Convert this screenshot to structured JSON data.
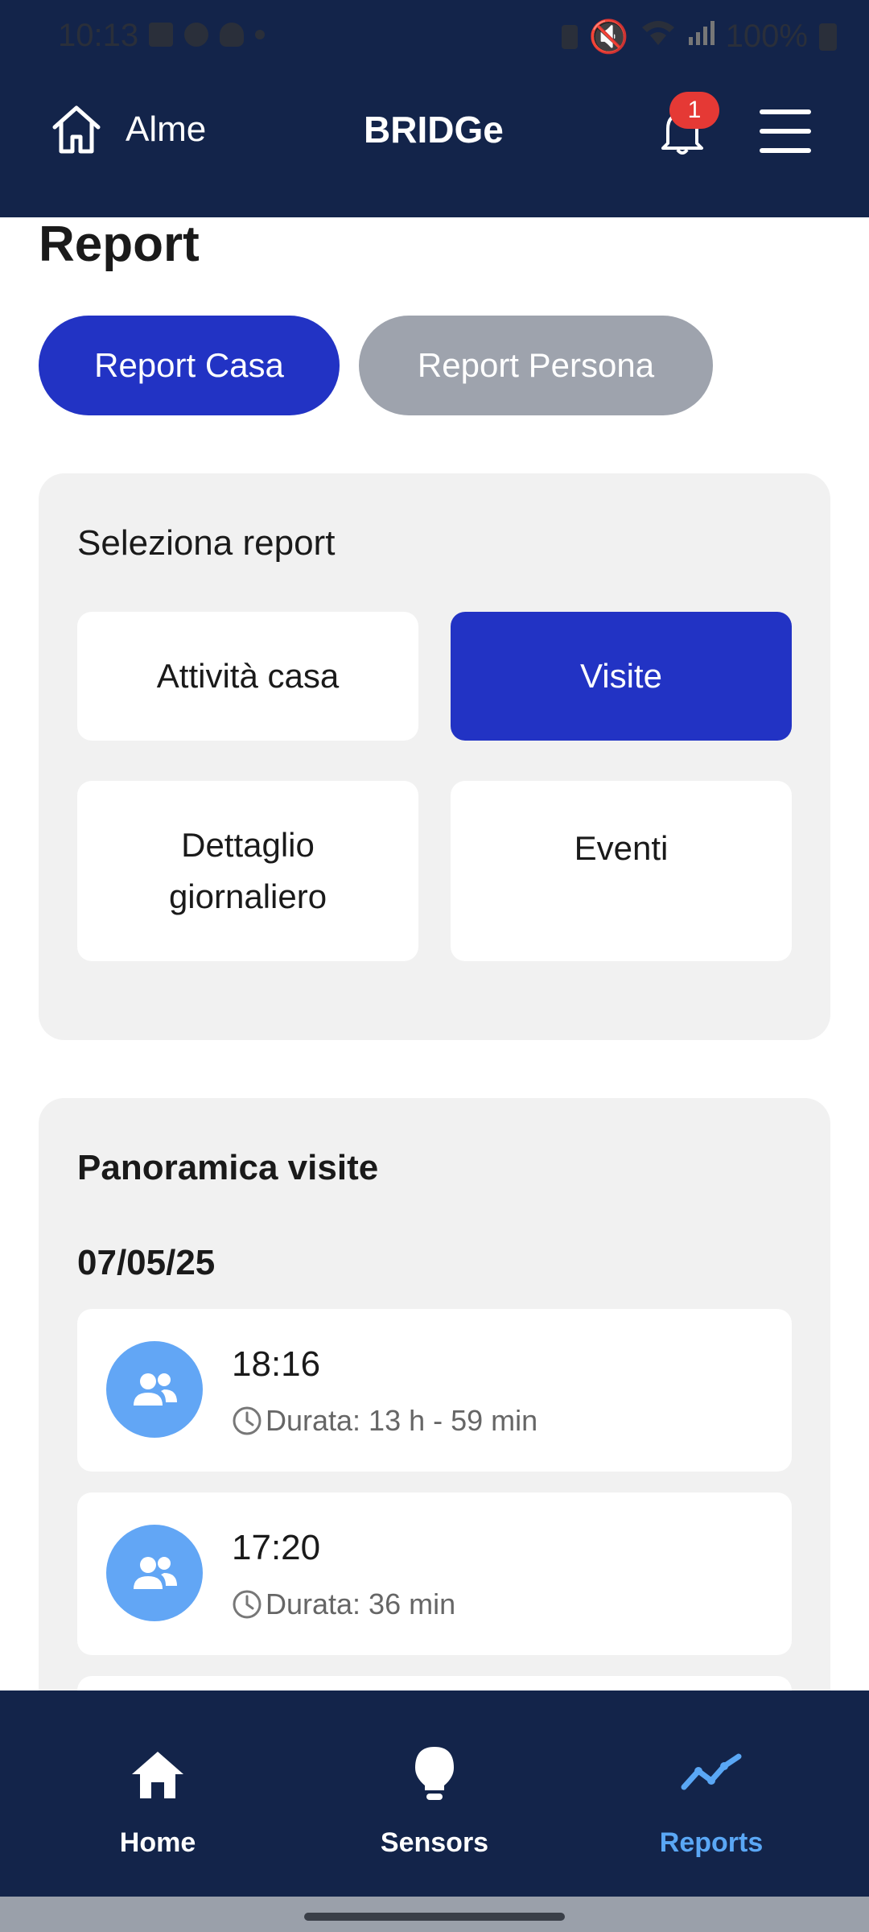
{
  "status_bar": {
    "time": "10:13",
    "battery": "100%"
  },
  "top_bar": {
    "location": "Alme",
    "app_title": "BRIDGe",
    "notification_count": "1"
  },
  "page": {
    "title": "Report"
  },
  "tabs": {
    "casa": "Report Casa",
    "persona": "Report Persona",
    "active": "casa"
  },
  "select_card": {
    "title": "Seleziona report",
    "options": [
      "Attività casa",
      "Visite",
      "Dettaglio\ngiornaliero",
      "Eventi"
    ],
    "active_index": 1
  },
  "visits_card": {
    "title": "Panoramica visite",
    "date": "07/05/25",
    "items": [
      {
        "time": "18:16",
        "duration": "Durata: 13 h - 59 min"
      },
      {
        "time": "17:20",
        "duration": "Durata: 36 min"
      }
    ]
  },
  "bottom_nav": {
    "home": "Home",
    "sensors": "Sensors",
    "reports": "Reports",
    "active": "reports"
  },
  "colors": {
    "header_bg": "#13244a",
    "accent": "#2233c4",
    "inactive_tab": "#9ea3ad",
    "avatar": "#62a6f5",
    "nav_active": "#5aa7f5"
  }
}
